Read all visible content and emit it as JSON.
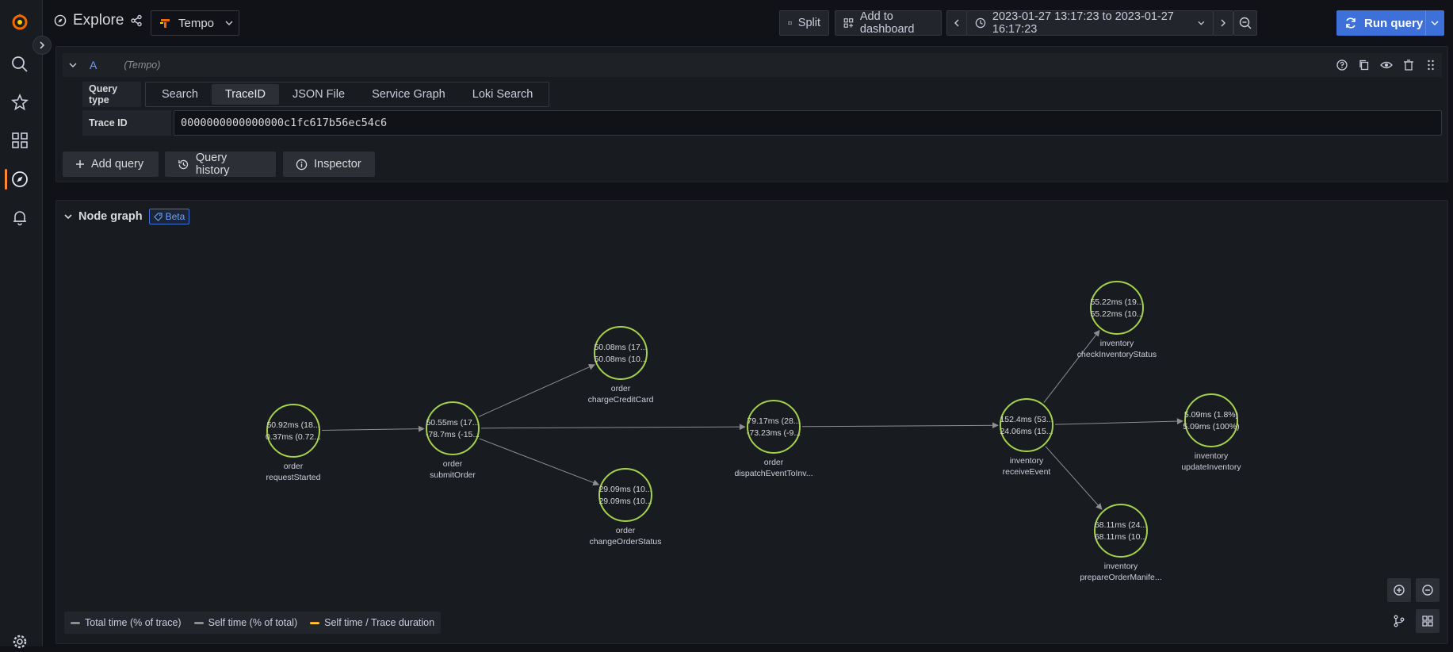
{
  "topbar": {
    "title": "Explore",
    "datasource": "Tempo",
    "split_label": "Split",
    "add_dashboard_label": "Add to dashboard",
    "time_range": "2023-01-27 13:17:23 to 2023-01-27 16:17:23",
    "run_query_label": "Run query"
  },
  "query": {
    "ref_id": "A",
    "datasource_hint": "(Tempo)",
    "query_type_label": "Query type",
    "tabs": [
      {
        "label": "Search",
        "active": false
      },
      {
        "label": "TraceID",
        "active": true
      },
      {
        "label": "JSON File",
        "active": false
      },
      {
        "label": "Service Graph",
        "active": false
      },
      {
        "label": "Loki Search",
        "active": false
      }
    ],
    "trace_id_label": "Trace ID",
    "trace_id_value": "0000000000000000c1fc617b56ec54c6",
    "add_query_label": "Add query",
    "query_history_label": "Query history",
    "inspector_label": "Inspector"
  },
  "graph": {
    "title": "Node graph",
    "badge": "Beta",
    "legend": [
      {
        "label": "Total time (% of trace)",
        "color": "#8e8e8e"
      },
      {
        "label": "Self time (% of total)",
        "color": "#8e8e8e"
      },
      {
        "label": "Self time / Trace duration",
        "color": "#ff9830"
      }
    ],
    "nodes": [
      {
        "id": "n1",
        "stat1": "50.92ms (18...",
        "stat2": "0.37ms (0.72...",
        "service": "order",
        "operation": "requestStarted"
      },
      {
        "id": "n2",
        "stat1": "50.55ms (17...",
        "stat2": "-78.7ms (-15...",
        "service": "order",
        "operation": "submitOrder"
      },
      {
        "id": "n3",
        "stat1": "50.08ms (17...",
        "stat2": "50.08ms (10...",
        "service": "order",
        "operation": "chargeCreditCard"
      },
      {
        "id": "n4",
        "stat1": "29.09ms (10...",
        "stat2": "29.09ms (10...",
        "service": "order",
        "operation": "changeOrderStatus"
      },
      {
        "id": "n5",
        "stat1": "79.17ms (28...",
        "stat2": "-73.23ms (-9...",
        "service": "order",
        "operation": "dispatchEventToInv..."
      },
      {
        "id": "n6",
        "stat1": "152.4ms (53...",
        "stat2": "24.06ms (15...",
        "service": "inventory",
        "operation": "receiveEvent"
      },
      {
        "id": "n7",
        "stat1": "55.22ms (19...",
        "stat2": "55.22ms (10...",
        "service": "inventory",
        "operation": "checkInventoryStatus"
      },
      {
        "id": "n8",
        "stat1": "5.09ms (1.8%)",
        "stat2": "5.09ms (100%)",
        "service": "inventory",
        "operation": "updateInventory"
      },
      {
        "id": "n9",
        "stat1": "68.11ms (24...",
        "stat2": "68.11ms (10...",
        "service": "inventory",
        "operation": "prepareOrderManife..."
      }
    ],
    "edges": [
      [
        "n1",
        "n2"
      ],
      [
        "n2",
        "n3"
      ],
      [
        "n2",
        "n5"
      ],
      [
        "n2",
        "n4"
      ],
      [
        "n5",
        "n6"
      ],
      [
        "n6",
        "n7"
      ],
      [
        "n6",
        "n8"
      ],
      [
        "n6",
        "n9"
      ]
    ],
    "colors": {
      "node_ring": "#a5d24a",
      "edge": "#8e8e93"
    }
  }
}
